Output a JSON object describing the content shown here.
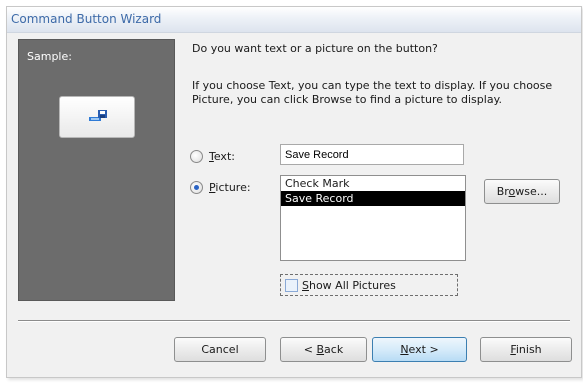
{
  "window": {
    "title": "Command Button Wizard"
  },
  "sample": {
    "label": "Sample:",
    "button_icon": "save-record-icon"
  },
  "prompt": {
    "question": "Do you want text or a picture on the button?",
    "info": "If you choose Text, you can type the text to display.  If you choose Picture, you can click Browse to find a picture to display."
  },
  "options": {
    "text": {
      "accel": "T",
      "rest": "ext:",
      "selected": false
    },
    "picture": {
      "accel": "P",
      "rest": "icture:",
      "selected": true
    }
  },
  "text_input": {
    "value": "Save Record"
  },
  "pictures": {
    "items": [
      "Check Mark",
      "Save Record"
    ],
    "selected": "Save Record"
  },
  "browse": {
    "pre": "Br",
    "accel": "o",
    "post": "wse..."
  },
  "show_all": {
    "accel": "S",
    "rest": "how All Pictures",
    "checked": false
  },
  "footer": {
    "cancel": "Cancel",
    "back": {
      "pre": "< ",
      "accel": "B",
      "post": "ack"
    },
    "next": {
      "accel": "N",
      "post": "ext >"
    },
    "finish": {
      "accel": "F",
      "post": "inish"
    }
  },
  "colors": {
    "accent": "#3d6aa8",
    "sample_bg": "#6c6c6c",
    "selection": "#000000"
  }
}
